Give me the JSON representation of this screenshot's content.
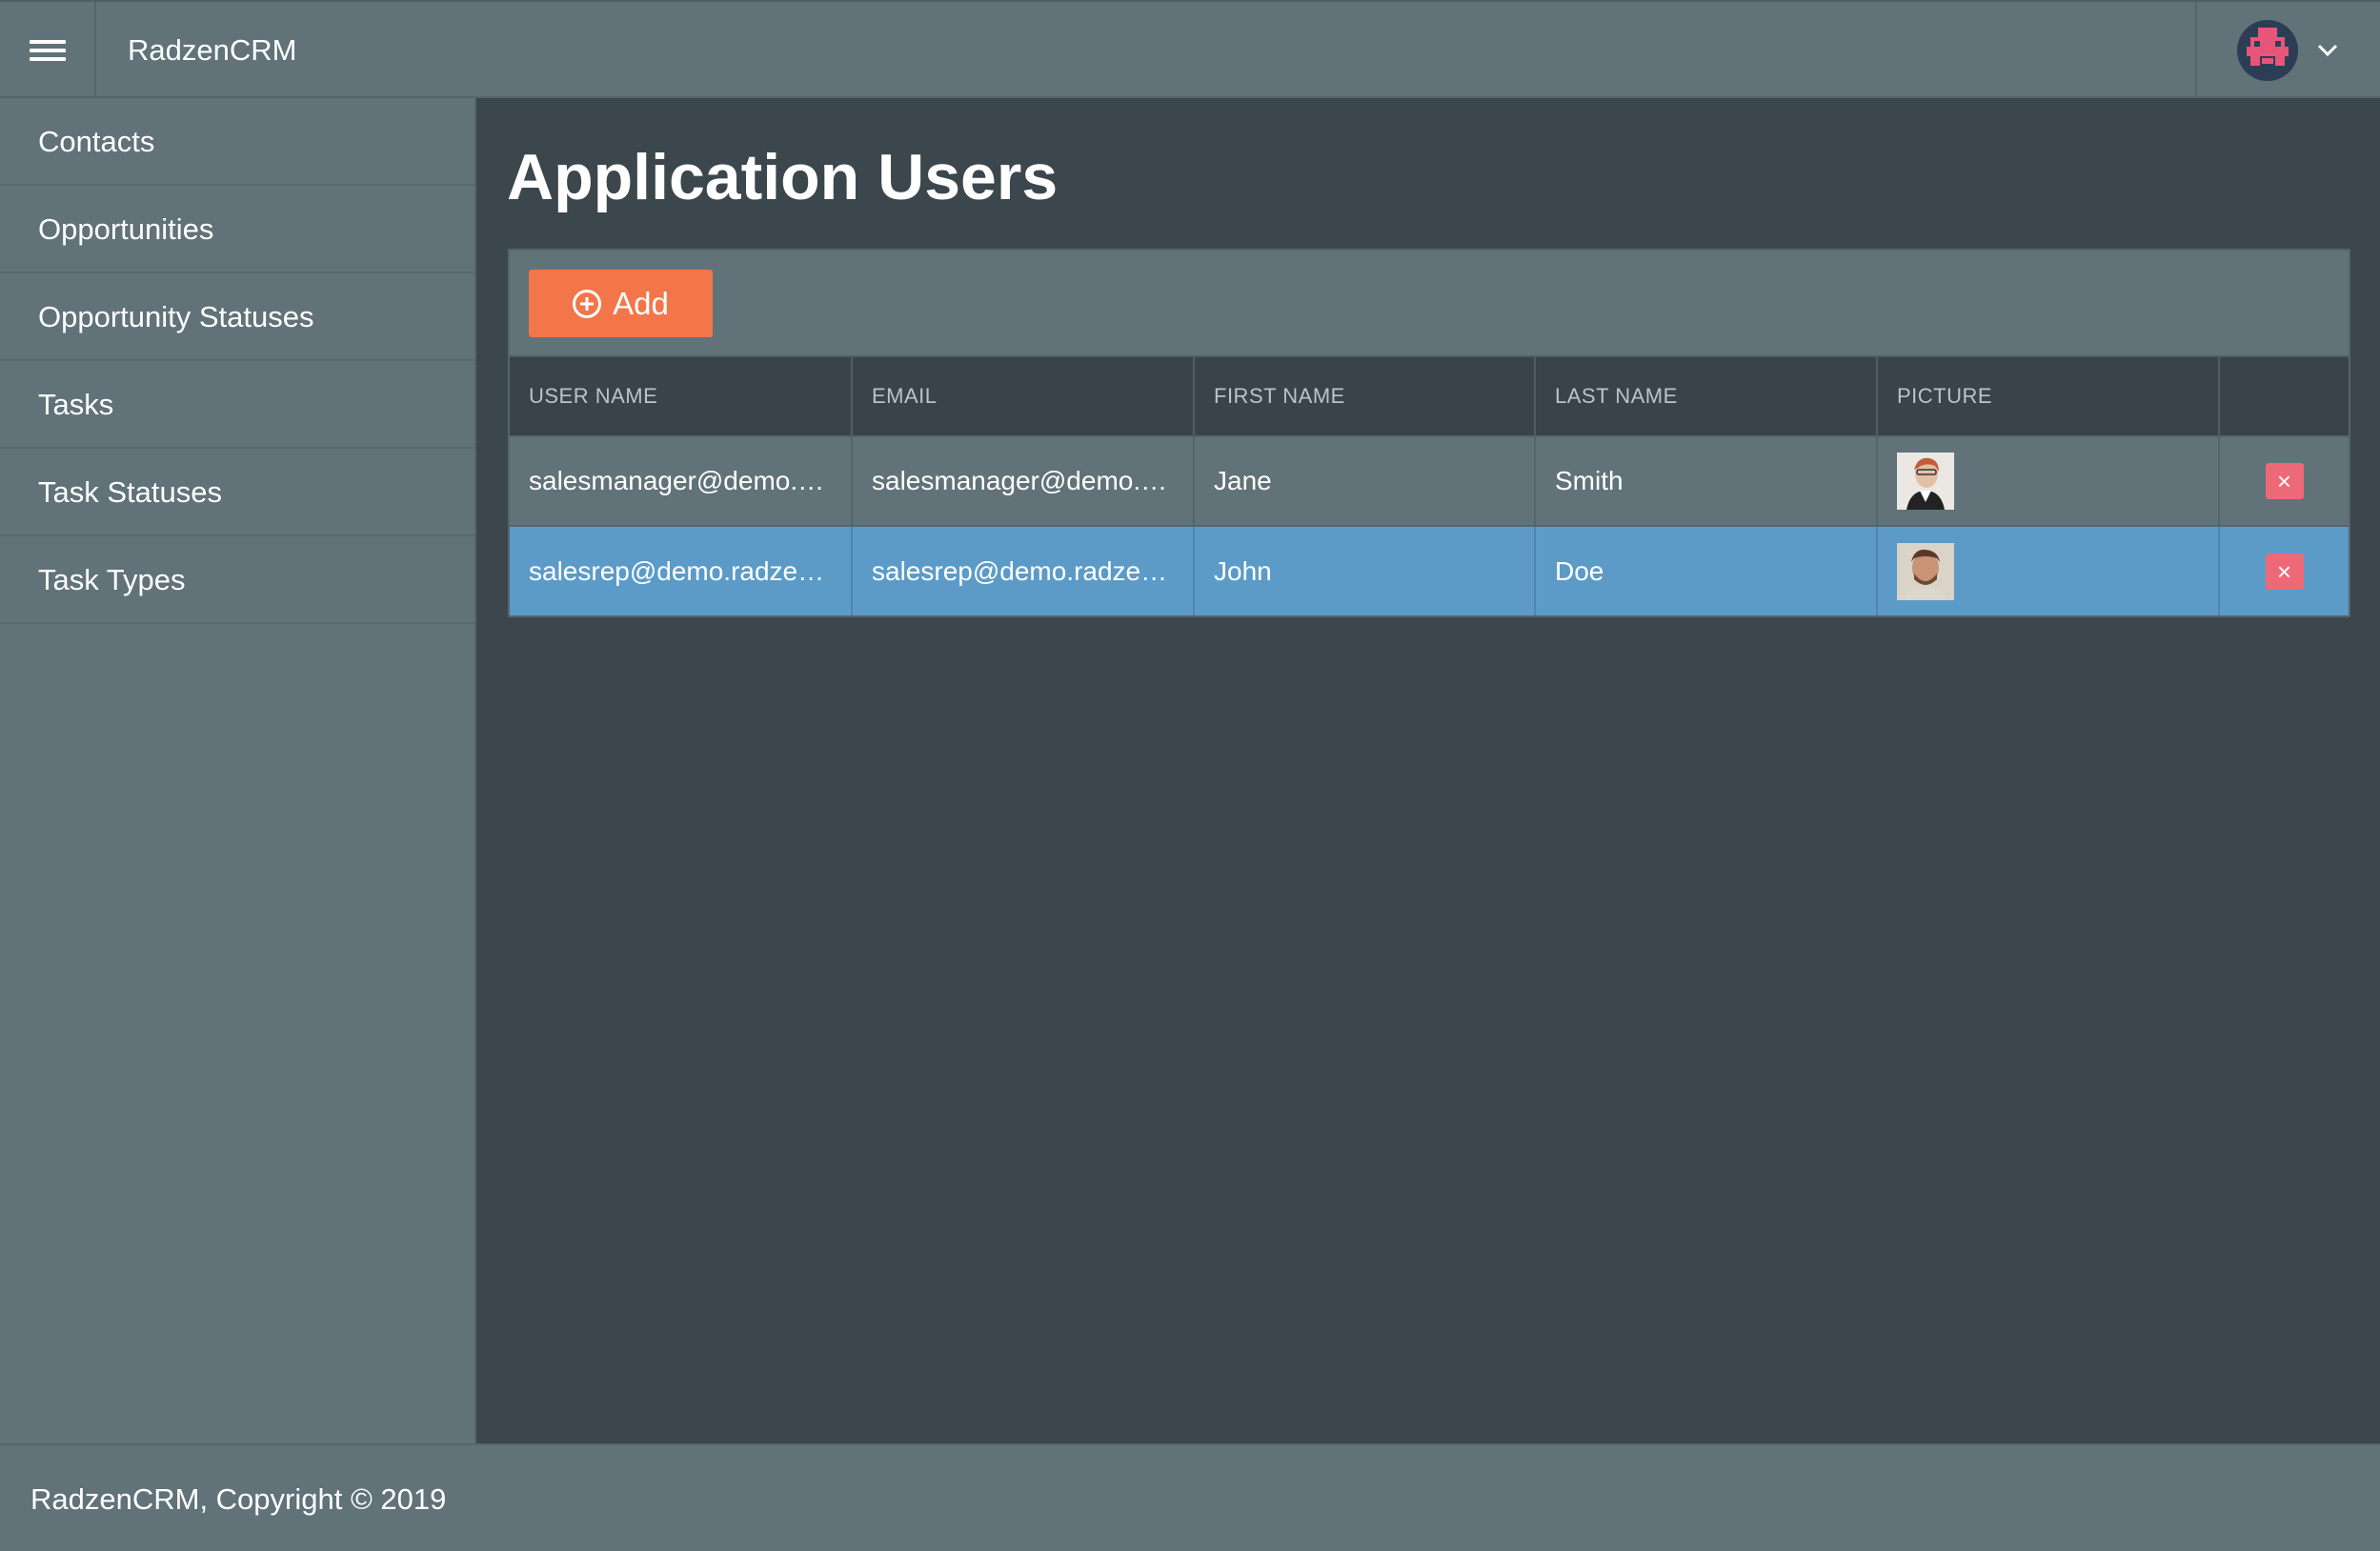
{
  "header": {
    "brand": "RadzenCRM",
    "menu_icon": "hamburger-icon",
    "profile_icon": "avatar-icon",
    "dropdown_icon": "chevron-down-icon"
  },
  "sidebar": {
    "items": [
      {
        "label": "Contacts"
      },
      {
        "label": "Opportunities"
      },
      {
        "label": "Opportunity Statuses"
      },
      {
        "label": "Tasks"
      },
      {
        "label": "Task Statuses"
      },
      {
        "label": "Task Types"
      }
    ]
  },
  "main": {
    "title": "Application Users",
    "toolbar": {
      "add_label": "Add",
      "add_icon": "add-circle-icon"
    },
    "table": {
      "columns": [
        "USER NAME",
        "EMAIL",
        "FIRST NAME",
        "LAST NAME",
        "PICTURE"
      ],
      "rows": [
        {
          "user_name": "salesmanager@demo.ra...",
          "email": "salesmanager@demo.ra...",
          "first_name": "Jane",
          "last_name": "Smith",
          "picture": "woman-portrait",
          "selected": false
        },
        {
          "user_name": "salesrep@demo.radzen....",
          "email": "salesrep@demo.radzen....",
          "first_name": "John",
          "last_name": "Doe",
          "picture": "man-portrait",
          "selected": true
        }
      ],
      "delete_symbol": "×"
    }
  },
  "footer": {
    "text": "RadzenCRM, Copyright © 2019"
  },
  "colors": {
    "accent": "#f27649",
    "selected_row": "#5c9bc7",
    "danger": "#ee6977",
    "panel": "#617279",
    "background": "#3b464d"
  }
}
